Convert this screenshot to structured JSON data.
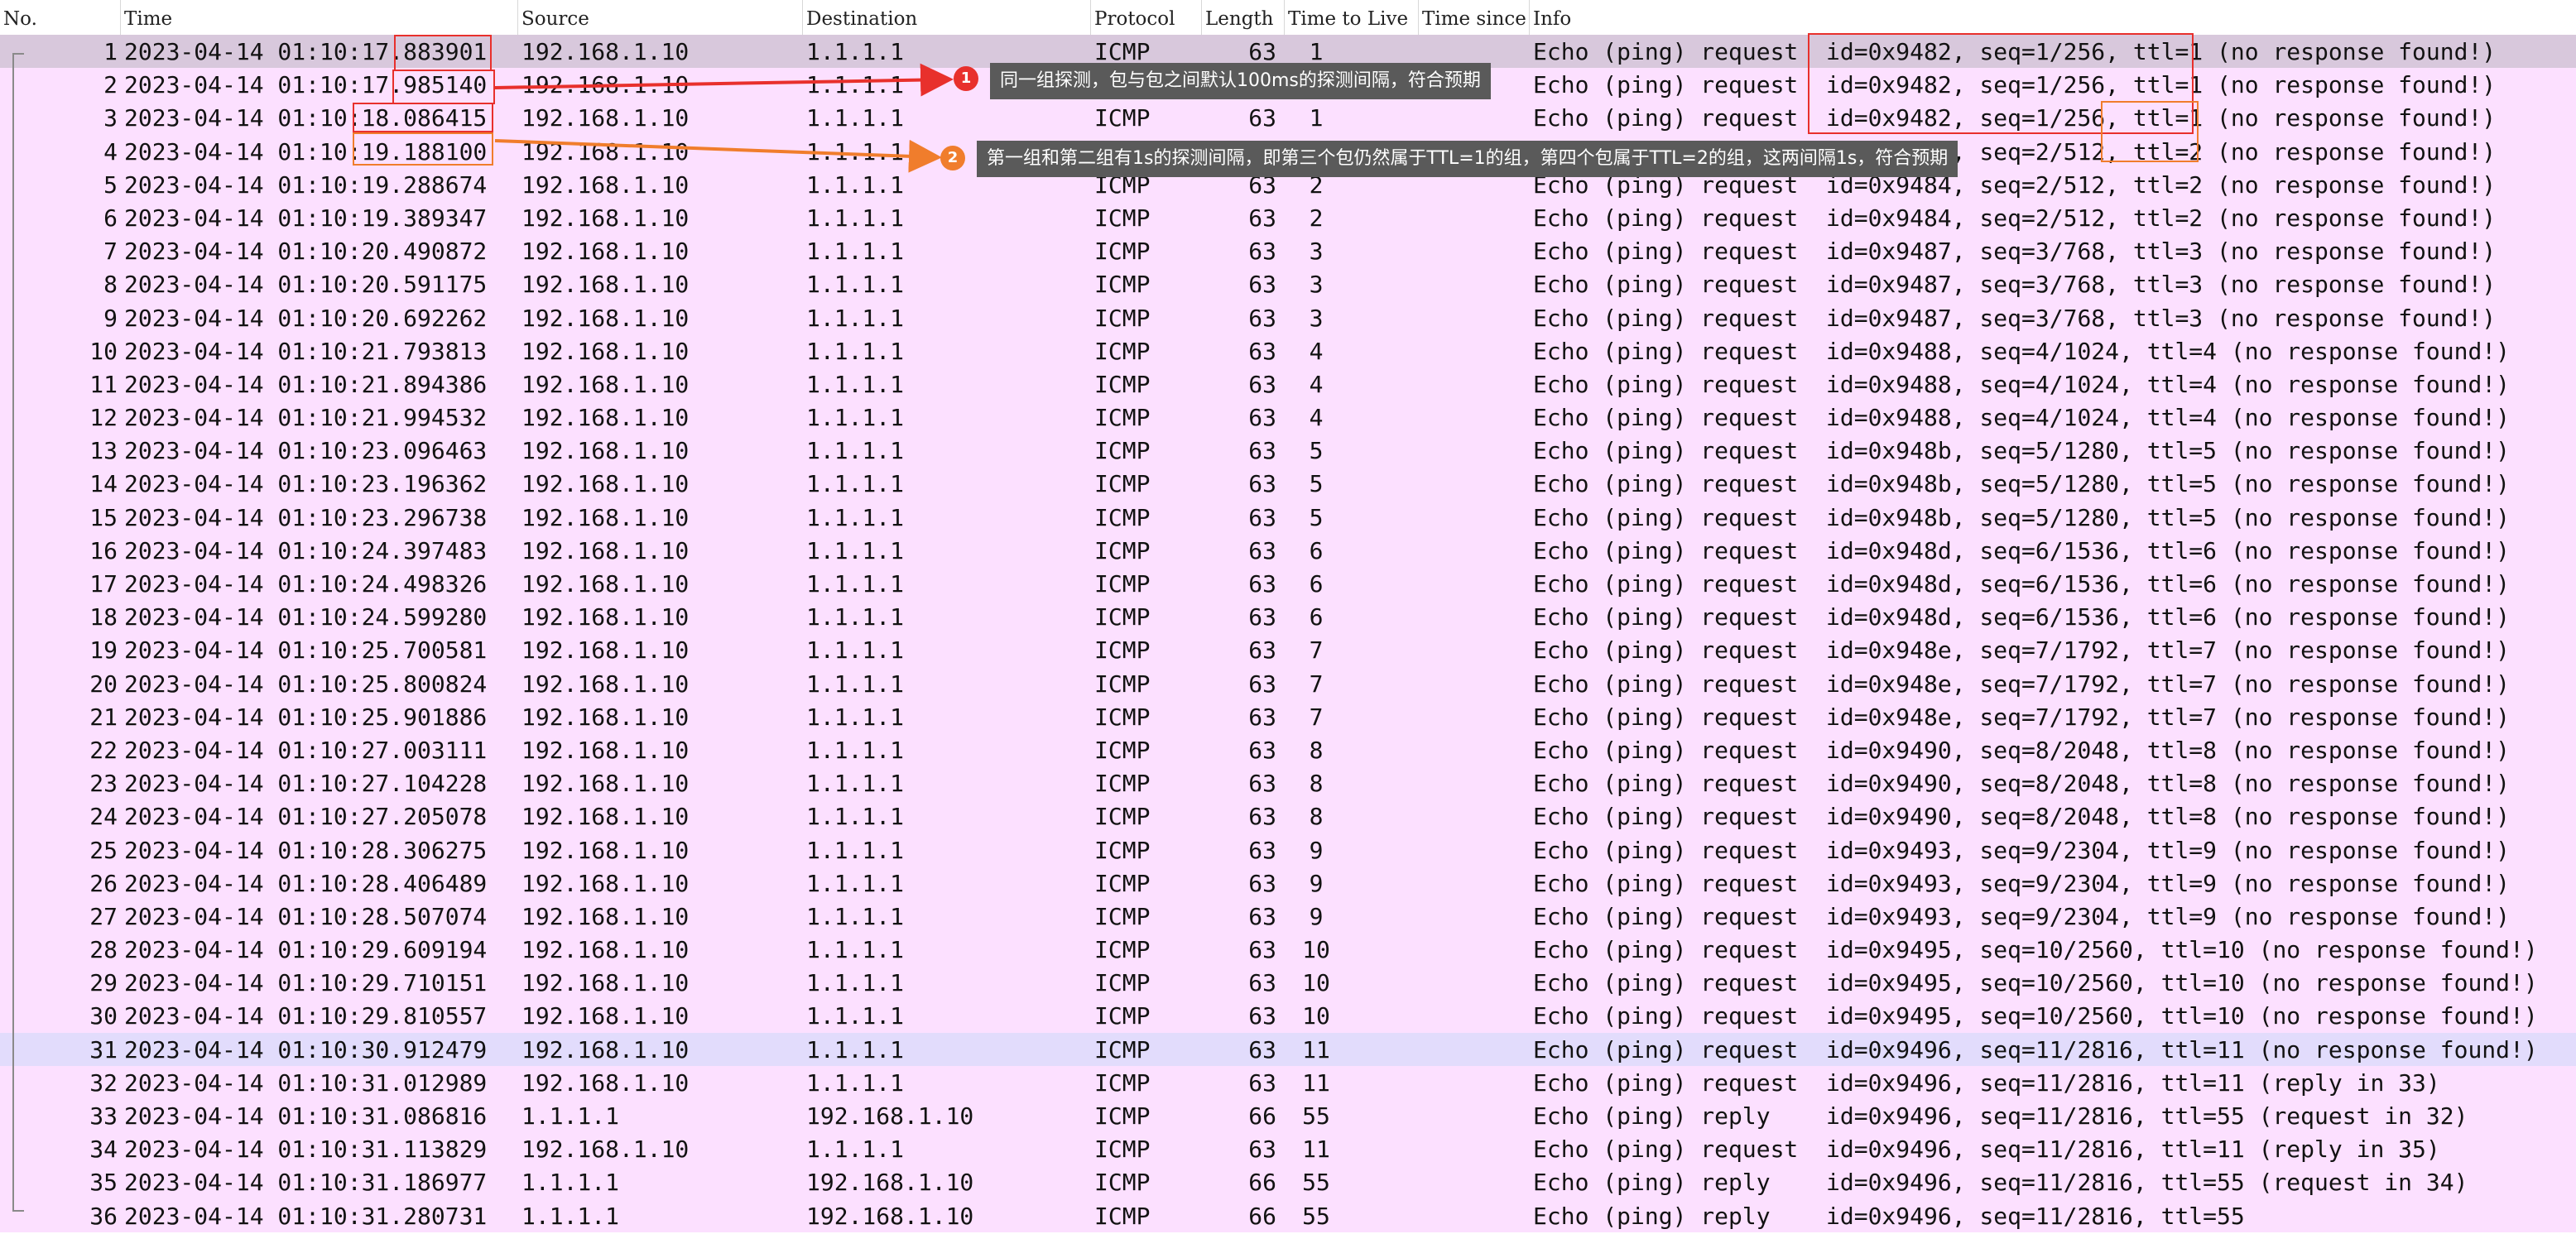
{
  "columns": [
    "No.",
    "Time",
    "Source",
    "Destination",
    "Protocol",
    "Length",
    "Time to Live",
    "Time since",
    "Info"
  ],
  "rows": [
    [
      "1",
      "2023-04-14 01:10:17.883901",
      "192.168.1.10",
      "1.1.1.1",
      "ICMP",
      "63",
      "1",
      "Echo (ping) request  id=0x9482, seq=1/256, ttl=1 (no response found!)"
    ],
    [
      "2",
      "2023-04-14 01:10:17.985140",
      "192.168.1.10",
      "1.1.1.1",
      "ICMP",
      "63",
      "1",
      "Echo (ping) request  id=0x9482, seq=1/256, ttl=1 (no response found!)"
    ],
    [
      "3",
      "2023-04-14 01:10:18.086415",
      "192.168.1.10",
      "1.1.1.1",
      "ICMP",
      "63",
      "1",
      "Echo (ping) request  id=0x9482, seq=1/256, ttl=1 (no response found!)"
    ],
    [
      "4",
      "2023-04-14 01:10:19.188100",
      "192.168.1.10",
      "1.1.1.1",
      "ICMP",
      "63",
      "2",
      "Echo (ping) request  id=0x9484, seq=2/512, ttl=2 (no response found!)"
    ],
    [
      "5",
      "2023-04-14 01:10:19.288674",
      "192.168.1.10",
      "1.1.1.1",
      "ICMP",
      "63",
      "2",
      "Echo (ping) request  id=0x9484, seq=2/512, ttl=2 (no response found!)"
    ],
    [
      "6",
      "2023-04-14 01:10:19.389347",
      "192.168.1.10",
      "1.1.1.1",
      "ICMP",
      "63",
      "2",
      "Echo (ping) request  id=0x9484, seq=2/512, ttl=2 (no response found!)"
    ],
    [
      "7",
      "2023-04-14 01:10:20.490872",
      "192.168.1.10",
      "1.1.1.1",
      "ICMP",
      "63",
      "3",
      "Echo (ping) request  id=0x9487, seq=3/768, ttl=3 (no response found!)"
    ],
    [
      "8",
      "2023-04-14 01:10:20.591175",
      "192.168.1.10",
      "1.1.1.1",
      "ICMP",
      "63",
      "3",
      "Echo (ping) request  id=0x9487, seq=3/768, ttl=3 (no response found!)"
    ],
    [
      "9",
      "2023-04-14 01:10:20.692262",
      "192.168.1.10",
      "1.1.1.1",
      "ICMP",
      "63",
      "3",
      "Echo (ping) request  id=0x9487, seq=3/768, ttl=3 (no response found!)"
    ],
    [
      "10",
      "2023-04-14 01:10:21.793813",
      "192.168.1.10",
      "1.1.1.1",
      "ICMP",
      "63",
      "4",
      "Echo (ping) request  id=0x9488, seq=4/1024, ttl=4 (no response found!)"
    ],
    [
      "11",
      "2023-04-14 01:10:21.894386",
      "192.168.1.10",
      "1.1.1.1",
      "ICMP",
      "63",
      "4",
      "Echo (ping) request  id=0x9488, seq=4/1024, ttl=4 (no response found!)"
    ],
    [
      "12",
      "2023-04-14 01:10:21.994532",
      "192.168.1.10",
      "1.1.1.1",
      "ICMP",
      "63",
      "4",
      "Echo (ping) request  id=0x9488, seq=4/1024, ttl=4 (no response found!)"
    ],
    [
      "13",
      "2023-04-14 01:10:23.096463",
      "192.168.1.10",
      "1.1.1.1",
      "ICMP",
      "63",
      "5",
      "Echo (ping) request  id=0x948b, seq=5/1280, ttl=5 (no response found!)"
    ],
    [
      "14",
      "2023-04-14 01:10:23.196362",
      "192.168.1.10",
      "1.1.1.1",
      "ICMP",
      "63",
      "5",
      "Echo (ping) request  id=0x948b, seq=5/1280, ttl=5 (no response found!)"
    ],
    [
      "15",
      "2023-04-14 01:10:23.296738",
      "192.168.1.10",
      "1.1.1.1",
      "ICMP",
      "63",
      "5",
      "Echo (ping) request  id=0x948b, seq=5/1280, ttl=5 (no response found!)"
    ],
    [
      "16",
      "2023-04-14 01:10:24.397483",
      "192.168.1.10",
      "1.1.1.1",
      "ICMP",
      "63",
      "6",
      "Echo (ping) request  id=0x948d, seq=6/1536, ttl=6 (no response found!)"
    ],
    [
      "17",
      "2023-04-14 01:10:24.498326",
      "192.168.1.10",
      "1.1.1.1",
      "ICMP",
      "63",
      "6",
      "Echo (ping) request  id=0x948d, seq=6/1536, ttl=6 (no response found!)"
    ],
    [
      "18",
      "2023-04-14 01:10:24.599280",
      "192.168.1.10",
      "1.1.1.1",
      "ICMP",
      "63",
      "6",
      "Echo (ping) request  id=0x948d, seq=6/1536, ttl=6 (no response found!)"
    ],
    [
      "19",
      "2023-04-14 01:10:25.700581",
      "192.168.1.10",
      "1.1.1.1",
      "ICMP",
      "63",
      "7",
      "Echo (ping) request  id=0x948e, seq=7/1792, ttl=7 (no response found!)"
    ],
    [
      "20",
      "2023-04-14 01:10:25.800824",
      "192.168.1.10",
      "1.1.1.1",
      "ICMP",
      "63",
      "7",
      "Echo (ping) request  id=0x948e, seq=7/1792, ttl=7 (no response found!)"
    ],
    [
      "21",
      "2023-04-14 01:10:25.901886",
      "192.168.1.10",
      "1.1.1.1",
      "ICMP",
      "63",
      "7",
      "Echo (ping) request  id=0x948e, seq=7/1792, ttl=7 (no response found!)"
    ],
    [
      "22",
      "2023-04-14 01:10:27.003111",
      "192.168.1.10",
      "1.1.1.1",
      "ICMP",
      "63",
      "8",
      "Echo (ping) request  id=0x9490, seq=8/2048, ttl=8 (no response found!)"
    ],
    [
      "23",
      "2023-04-14 01:10:27.104228",
      "192.168.1.10",
      "1.1.1.1",
      "ICMP",
      "63",
      "8",
      "Echo (ping) request  id=0x9490, seq=8/2048, ttl=8 (no response found!)"
    ],
    [
      "24",
      "2023-04-14 01:10:27.205078",
      "192.168.1.10",
      "1.1.1.1",
      "ICMP",
      "63",
      "8",
      "Echo (ping) request  id=0x9490, seq=8/2048, ttl=8 (no response found!)"
    ],
    [
      "25",
      "2023-04-14 01:10:28.306275",
      "192.168.1.10",
      "1.1.1.1",
      "ICMP",
      "63",
      "9",
      "Echo (ping) request  id=0x9493, seq=9/2304, ttl=9 (no response found!)"
    ],
    [
      "26",
      "2023-04-14 01:10:28.406489",
      "192.168.1.10",
      "1.1.1.1",
      "ICMP",
      "63",
      "9",
      "Echo (ping) request  id=0x9493, seq=9/2304, ttl=9 (no response found!)"
    ],
    [
      "27",
      "2023-04-14 01:10:28.507074",
      "192.168.1.10",
      "1.1.1.1",
      "ICMP",
      "63",
      "9",
      "Echo (ping) request  id=0x9493, seq=9/2304, ttl=9 (no response found!)"
    ],
    [
      "28",
      "2023-04-14 01:10:29.609194",
      "192.168.1.10",
      "1.1.1.1",
      "ICMP",
      "63",
      "10",
      "Echo (ping) request  id=0x9495, seq=10/2560, ttl=10 (no response found!)"
    ],
    [
      "29",
      "2023-04-14 01:10:29.710151",
      "192.168.1.10",
      "1.1.1.1",
      "ICMP",
      "63",
      "10",
      "Echo (ping) request  id=0x9495, seq=10/2560, ttl=10 (no response found!)"
    ],
    [
      "30",
      "2023-04-14 01:10:29.810557",
      "192.168.1.10",
      "1.1.1.1",
      "ICMP",
      "63",
      "10",
      "Echo (ping) request  id=0x9495, seq=10/2560, ttl=10 (no response found!)"
    ],
    [
      "31",
      "2023-04-14 01:10:30.912479",
      "192.168.1.10",
      "1.1.1.1",
      "ICMP",
      "63",
      "11",
      "Echo (ping) request  id=0x9496, seq=11/2816, ttl=11 (no response found!)"
    ],
    [
      "32",
      "2023-04-14 01:10:31.012989",
      "192.168.1.10",
      "1.1.1.1",
      "ICMP",
      "63",
      "11",
      "Echo (ping) request  id=0x9496, seq=11/2816, ttl=11 (reply in 33)"
    ],
    [
      "33",
      "2023-04-14 01:10:31.086816",
      "1.1.1.1",
      "192.168.1.10",
      "ICMP",
      "66",
      "55",
      "Echo (ping) reply    id=0x9496, seq=11/2816, ttl=55 (request in 32)"
    ],
    [
      "34",
      "2023-04-14 01:10:31.113829",
      "192.168.1.10",
      "1.1.1.1",
      "ICMP",
      "63",
      "11",
      "Echo (ping) request  id=0x9496, seq=11/2816, ttl=11 (reply in 35)"
    ],
    [
      "35",
      "2023-04-14 01:10:31.186977",
      "1.1.1.1",
      "192.168.1.10",
      "ICMP",
      "66",
      "55",
      "Echo (ping) reply    id=0x9496, seq=11/2816, ttl=55 (request in 34)"
    ],
    [
      "36",
      "2023-04-14 01:10:31.280731",
      "1.1.1.1",
      "192.168.1.10",
      "ICMP",
      "66",
      "55",
      "Echo (ping) reply    id=0x9496, seq=11/2816, ttl=55"
    ]
  ],
  "annotations": {
    "note1_number": "1",
    "note1_text": "同一组探测，包与包之间默认100ms的探测间隔，符合预期",
    "note2_number": "2",
    "note2_text": "第一组和第二组有1s的探测间隔，即第三个包仍然属于TTL=1的组，第四个包属于TTL=2的组，这两间隔1s，符合预期"
  },
  "colors": {
    "icmp_row": "#fce0ff",
    "selected_row": "#d8c8dc",
    "highlighted_row": "#e2dcfc",
    "annotation_red": "#e8302c",
    "annotation_orange": "#f07d2c",
    "callout_bg": "#5a5a5a"
  }
}
